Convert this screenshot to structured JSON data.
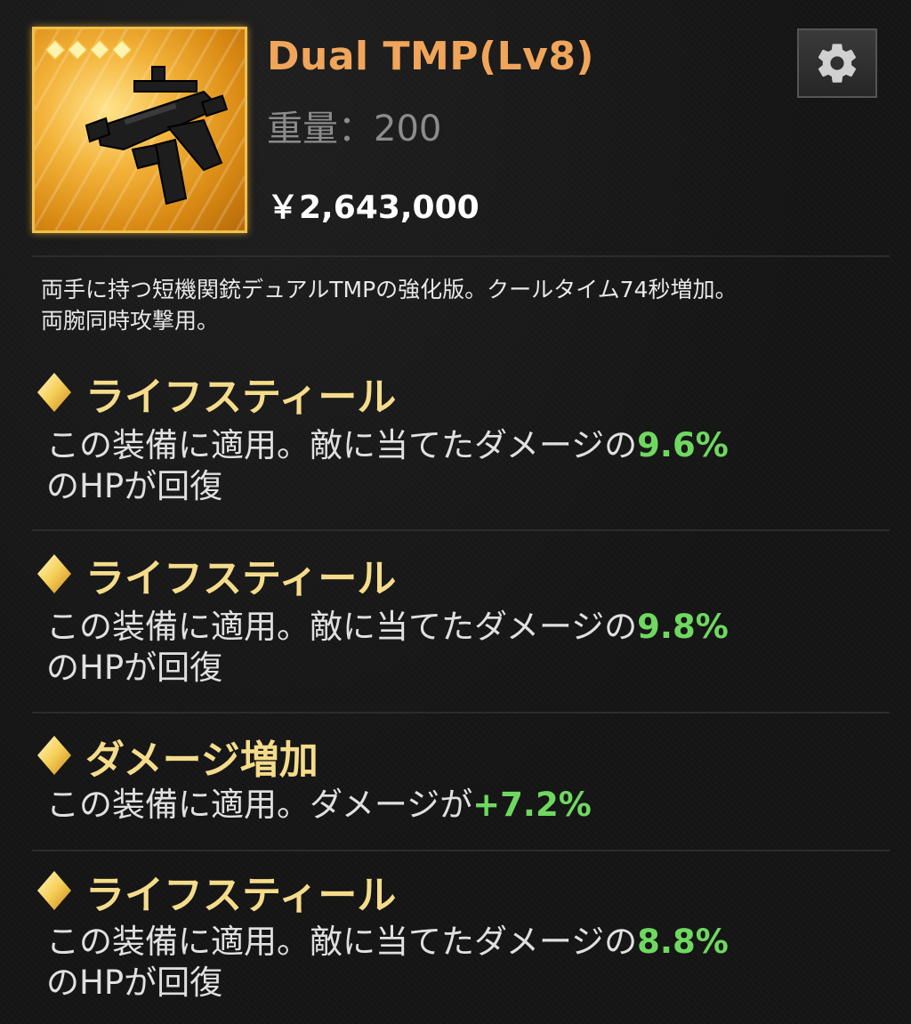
{
  "item": {
    "name": "Dual TMP(Lv8)",
    "weight_label": "重量：",
    "weight_value": "200",
    "price": "￥2,643,000",
    "star_count": 4,
    "icon": "submachine-gun-icon"
  },
  "settings": {
    "icon": "gear-icon"
  },
  "description": {
    "lines": [
      "両手に持つ短機関銃デュアルTMPの強化版。クールタイム74秒増加。",
      "両腕同時攻撃用。"
    ]
  },
  "effects": [
    {
      "title": "ライフスティール",
      "text_before": "この装備に適用。敵に当てたダメージの",
      "value": "9.6%",
      "text_after": "のHPが回復"
    },
    {
      "title": "ライフスティール",
      "text_before": "この装備に適用。敵に当てたダメージの",
      "value": "9.8%",
      "text_after": "のHPが回復"
    },
    {
      "title": "ダメージ増加",
      "text_before": "この装備に適用。ダメージが",
      "value": "+7.2%",
      "text_after": ""
    },
    {
      "title": "ライフスティール",
      "text_before": "この装備に適用。敵に当てたダメージの",
      "value": "8.8%",
      "text_after": "のHPが回復"
    }
  ],
  "colors": {
    "title": "#f0a55a",
    "effect_title": "#f5dc8a",
    "value_green": "#6fd860",
    "frame_gold": "#f2c04a"
  }
}
